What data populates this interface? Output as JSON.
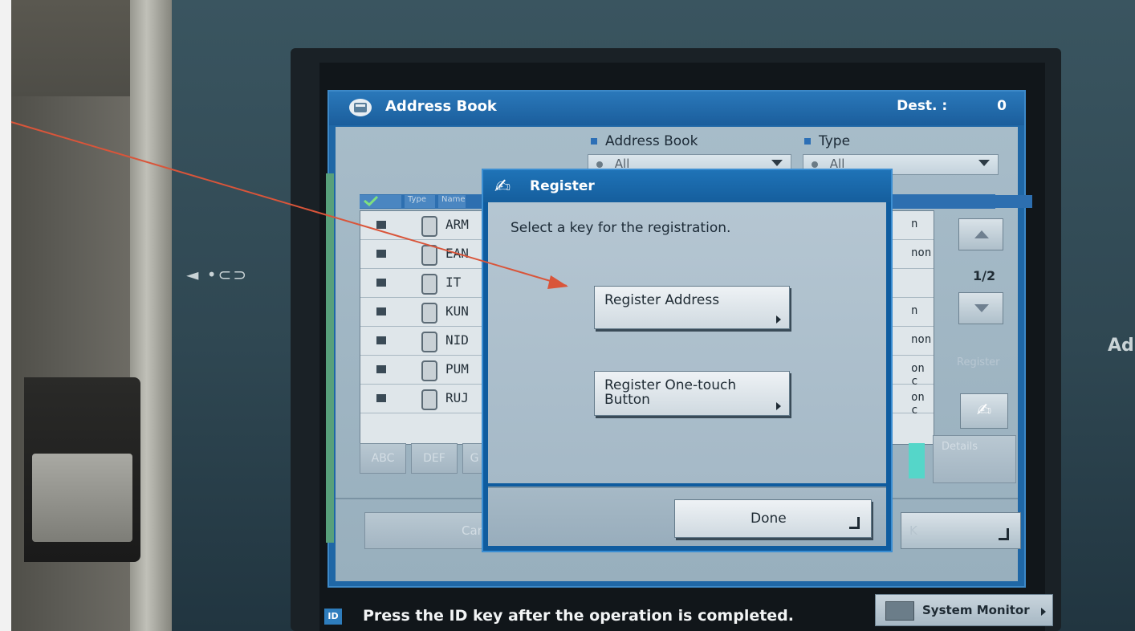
{
  "address_book": {
    "title": "Address Book",
    "dest_label": "Dest. :",
    "dest_count": "0",
    "filter_address_book_label": "Address Book",
    "filter_type_label": "Type",
    "dropdown_address_book_value": "All",
    "dropdown_type_value": "All",
    "header_type": "Type",
    "header_name": "Name",
    "rows": [
      {
        "name": "ARM",
        "right": "n"
      },
      {
        "name": "EAN",
        "right": "non"
      },
      {
        "name": "IT",
        "right": ""
      },
      {
        "name": "KUN",
        "right": "n"
      },
      {
        "name": "NID",
        "right": "non"
      },
      {
        "name": "PUM",
        "right": "on c"
      },
      {
        "name": "RUJ",
        "right": "on c"
      }
    ],
    "page_indicator": "1/2",
    "register_label": "Register",
    "letter_tabs": [
      "ABC",
      "DEF",
      "G"
    ],
    "details_label": "Details",
    "cancel_label": "Cance",
    "ok_label": "K"
  },
  "register_dialog": {
    "title": "Register",
    "message": "Select a key for the registration.",
    "register_address_label": "Register Address",
    "register_onetouch_label_line1": "Register One-touch",
    "register_onetouch_label_line2": "Button",
    "done_label": "Done"
  },
  "status_bar": {
    "id_badge": "ID",
    "message": "Press the ID key after the operation is completed.",
    "system_monitor_label": "System Monitor"
  },
  "device": {
    "usb_symbol": "◄ •⊂⊃",
    "side_text": "Ad"
  },
  "colors": {
    "title_blue": "#1f67a6",
    "body_gray_blue": "#a7bcc9",
    "annotation_red": "#d9553a"
  }
}
